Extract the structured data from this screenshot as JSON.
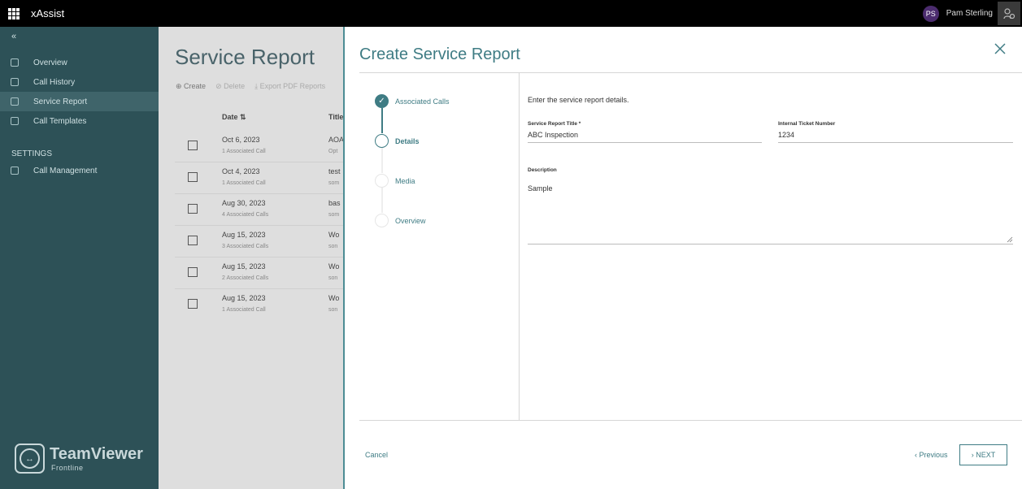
{
  "topbar": {
    "app_name": "xAssist",
    "user_initials": "PS",
    "user_name": "Pam Sterling"
  },
  "sidebar": {
    "items": [
      {
        "label": "Overview",
        "icon": "home-icon"
      },
      {
        "label": "Call History",
        "icon": "phone-icon"
      },
      {
        "label": "Service Report",
        "icon": "clipboard-icon",
        "active": true
      },
      {
        "label": "Call Templates",
        "icon": "template-icon"
      }
    ],
    "settings_heading": "SETTINGS",
    "settings_items": [
      {
        "label": "Call Management",
        "icon": "network-icon"
      }
    ],
    "logo_word": "TeamViewer",
    "logo_sub": "Frontline"
  },
  "background_page": {
    "title": "Service Report",
    "toolbar": {
      "create": "Create",
      "delete": "Delete",
      "export": "Export PDF Reports"
    },
    "columns": {
      "date": "Date",
      "title": "Title"
    },
    "rows": [
      {
        "date": "Oct 6, 2023",
        "calls": "1 Associated Call",
        "title": "AOA",
        "sub": "Opt"
      },
      {
        "date": "Oct 4, 2023",
        "calls": "1 Associated Call",
        "title": "test",
        "sub": "som"
      },
      {
        "date": "Aug 30, 2023",
        "calls": "4 Associated Calls",
        "title": "bas",
        "sub": "som"
      },
      {
        "date": "Aug 15, 2023",
        "calls": "3 Associated Calls",
        "title": "Wo",
        "sub": "son"
      },
      {
        "date": "Aug 15, 2023",
        "calls": "2 Associated Calls",
        "title": "Wo",
        "sub": "son"
      },
      {
        "date": "Aug 15, 2023",
        "calls": "1 Associated Call",
        "title": "Wo",
        "sub": "son"
      }
    ]
  },
  "modal": {
    "title": "Create Service Report",
    "steps": [
      {
        "label": "Associated Calls",
        "state": "done"
      },
      {
        "label": "Details",
        "state": "current"
      },
      {
        "label": "Media",
        "state": "todo"
      },
      {
        "label": "Overview",
        "state": "todo"
      }
    ],
    "intro": "Enter the service report details.",
    "fields": {
      "title_label": "Service Report Title *",
      "title_value": "ABC Inspection",
      "ticket_label": "Internal Ticket Number",
      "ticket_value": "1234",
      "description_label": "Description",
      "description_value": "Sample"
    },
    "cancel": "Cancel",
    "previous": "Previous",
    "next": "NEXT"
  },
  "colors": {
    "accent": "#3f7c84",
    "sidebar": "#2d5157",
    "topbar": "#000000"
  }
}
